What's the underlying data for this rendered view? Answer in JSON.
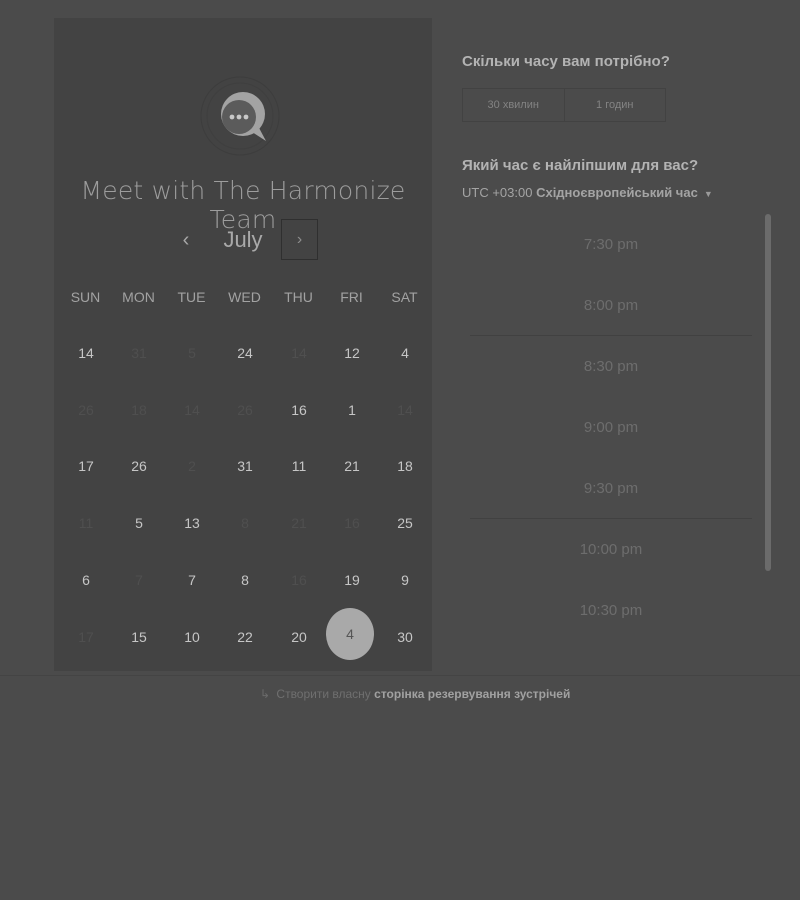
{
  "meeting": {
    "title": "Meet with The Harmonize Team"
  },
  "calendar": {
    "month": "July",
    "prev_icon": "chevron-left-icon",
    "next_icon": "chevron-right-icon",
    "prev_glyph": "‹",
    "next_glyph": "›",
    "weekdays": [
      "SUN",
      "MON",
      "TUE",
      "WED",
      "THU",
      "FRI",
      "SAT"
    ],
    "weeks": [
      [
        {
          "d": "14",
          "muted": false
        },
        {
          "d": "31",
          "muted": true
        },
        {
          "d": "5",
          "muted": true
        },
        {
          "d": "24",
          "muted": false
        },
        {
          "d": "14",
          "muted": true
        },
        {
          "d": "12",
          "muted": false
        },
        {
          "d": "4",
          "muted": false
        }
      ],
      [
        {
          "d": "26",
          "muted": true
        },
        {
          "d": "18",
          "muted": true
        },
        {
          "d": "14",
          "muted": true
        },
        {
          "d": "26",
          "muted": true
        },
        {
          "d": "16",
          "muted": false
        },
        {
          "d": "1",
          "muted": false
        },
        {
          "d": "14",
          "muted": true
        }
      ],
      [
        {
          "d": "17",
          "muted": false
        },
        {
          "d": "26",
          "muted": false
        },
        {
          "d": "2",
          "muted": true
        },
        {
          "d": "31",
          "muted": false
        },
        {
          "d": "11",
          "muted": false
        },
        {
          "d": "21",
          "muted": false
        },
        {
          "d": "18",
          "muted": false
        }
      ],
      [
        {
          "d": "11",
          "muted": true
        },
        {
          "d": "5",
          "muted": false
        },
        {
          "d": "13",
          "muted": false
        },
        {
          "d": "8",
          "muted": true
        },
        {
          "d": "21",
          "muted": true
        },
        {
          "d": "16",
          "muted": true
        },
        {
          "d": "25",
          "muted": false
        }
      ],
      [
        {
          "d": "6",
          "muted": false
        },
        {
          "d": "7",
          "muted": true
        },
        {
          "d": "7",
          "muted": false
        },
        {
          "d": "8",
          "muted": false
        },
        {
          "d": "16",
          "muted": true
        },
        {
          "d": "19",
          "muted": false
        },
        {
          "d": "9",
          "muted": false
        }
      ],
      [
        {
          "d": "17",
          "muted": true
        },
        {
          "d": "15",
          "muted": false
        },
        {
          "d": "10",
          "muted": false
        },
        {
          "d": "22",
          "muted": false
        },
        {
          "d": "20",
          "muted": false
        },
        {
          "d": "4",
          "muted": false,
          "selected": true
        },
        {
          "d": "30",
          "muted": false
        }
      ]
    ]
  },
  "duration": {
    "question": "Скільки часу вам потрібно?",
    "options": [
      "30 хвилин",
      "1 годин"
    ]
  },
  "time_picker": {
    "question": "Який час є найліпшим для вас?",
    "tz_offset": "UTC +03:00",
    "tz_name": "Східноєвропейський час",
    "tz_caret": "▼",
    "slots": [
      "7:30 pm",
      "8:00 pm",
      "8:30 pm",
      "9:00 pm",
      "9:30 pm",
      "10:00 pm",
      "10:30 pm"
    ]
  },
  "footer": {
    "prefix": "Створити власну",
    "link": "сторінка резервування зустрічей",
    "icon": "sprout-icon",
    "icon_glyph": "↳"
  },
  "colors": {
    "background": "#4b4b4b",
    "panel": "#434343",
    "selected_day": "#a9a9a9"
  }
}
